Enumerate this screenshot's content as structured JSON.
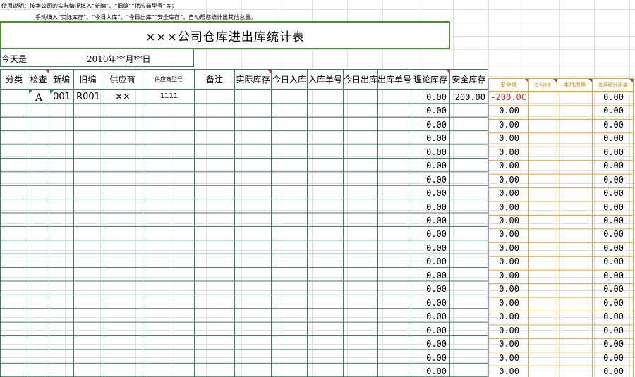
{
  "instructions": {
    "line1": "使用说明：按本公司的实际情况填入“新编”、“旧编”“供应商型号”等；",
    "line2": "手动填入“实际库存”、“今日入库”、“今日出库”“安全库存”，自动帮您统计出其他总量。"
  },
  "sheet": {
    "title": "×××公司仓库进出库统计表",
    "date_label": "今天是",
    "date_value": "2010年**月**日"
  },
  "columns": [
    "分类",
    "检查",
    "新编",
    "旧编",
    "供应商",
    "供应商型号",
    "备注",
    "实际库存",
    "今日入库",
    "入库单号",
    "今日出库",
    "出库单号",
    "理论库存",
    "安全库存"
  ],
  "right_columns": [
    "安全线",
    "安全检查",
    "本月用量",
    "本月统计用量"
  ],
  "first_row": {
    "category": "",
    "check": "A",
    "new_code": "001",
    "old_code": "R001",
    "supplier": "××",
    "supplier_model": "1111",
    "theory_stock": "0.00",
    "safety_stock": "200.00",
    "safety_line": "-200.0C",
    "monthly_stat": "0.00"
  },
  "rows": [
    {
      "theory_stock": "0.00",
      "safety_line": "0.00",
      "monthly_stat": "0.00"
    },
    {
      "theory_stock": "0.00",
      "safety_line": "0.00",
      "monthly_stat": "0.00"
    },
    {
      "theory_stock": "0.00",
      "safety_line": "0.00",
      "monthly_stat": "0.00"
    },
    {
      "theory_stock": "0.00",
      "safety_line": "0.00",
      "monthly_stat": "0.00"
    },
    {
      "theory_stock": "0.00",
      "safety_line": "0.00",
      "monthly_stat": "0.00"
    },
    {
      "theory_stock": "0.00",
      "safety_line": "0.00",
      "monthly_stat": "0.00"
    },
    {
      "theory_stock": "0.00",
      "safety_line": "0.00",
      "monthly_stat": "0.00"
    },
    {
      "theory_stock": "0.00",
      "safety_line": "0.00",
      "monthly_stat": "0.00"
    },
    {
      "theory_stock": "0.00",
      "safety_line": "0.00",
      "monthly_stat": "0.00"
    },
    {
      "theory_stock": "0.00",
      "safety_line": "0.00",
      "monthly_stat": "0.00"
    },
    {
      "theory_stock": "0.00",
      "safety_line": "0.00",
      "monthly_stat": "0.00"
    },
    {
      "theory_stock": "0.00",
      "safety_line": "0.00",
      "monthly_stat": "0.00"
    },
    {
      "theory_stock": "0.00",
      "safety_line": "0.00",
      "monthly_stat": "0.00"
    },
    {
      "theory_stock": "0.00",
      "safety_line": "0.00",
      "monthly_stat": "0.00"
    },
    {
      "theory_stock": "0.00",
      "safety_line": "0.00",
      "monthly_stat": "0.00"
    },
    {
      "theory_stock": "0.00",
      "safety_line": "0.00",
      "monthly_stat": "0.00"
    },
    {
      "theory_stock": "0.00",
      "safety_line": "0.00",
      "monthly_stat": "0.00"
    },
    {
      "theory_stock": "0.00",
      "safety_line": "0.00",
      "monthly_stat": "0.00"
    },
    {
      "theory_stock": "0.00",
      "safety_line": "0.00",
      "monthly_stat": "0.00"
    },
    {
      "theory_stock": "0.00",
      "safety_line": "0.00",
      "monthly_stat": "0.00"
    }
  ],
  "colors": {
    "table_border": "#3c7f6c",
    "title_border": "#4f8a3c",
    "comment_marker": "#d93030",
    "right_border": "#e8a33d",
    "safety_line_border": "#e07ab2",
    "negative_value": "#d93030"
  }
}
